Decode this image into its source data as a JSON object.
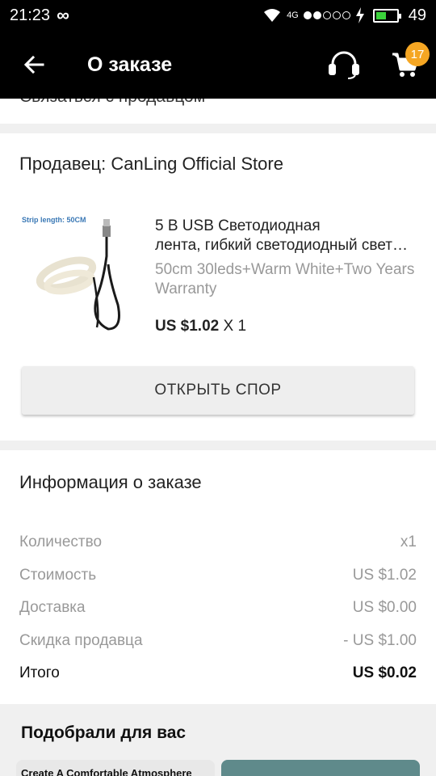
{
  "status_bar": {
    "time": "21:23",
    "network": "4G",
    "battery_level": "49",
    "battery_fill_fraction": 0.49
  },
  "app_bar": {
    "title": "О заказе",
    "cart_badge": "17"
  },
  "contact_seller": {
    "label": "Связаться с продавцом"
  },
  "seller_section": {
    "seller_label": "Продавец: CanLing Official Store",
    "product": {
      "image_caption": "Strip length: 50CM",
      "title_line1": "5 В USB Светодиодная",
      "title_line2": "лента, гибкий светодиодный светильник",
      "variant": "50cm 30leds+Warm White+Two Years Warranty",
      "price": "US $1.02",
      "quantity": "X 1"
    },
    "dispute_button": "ОТКРЫТЬ СПОР"
  },
  "order_info": {
    "title": "Информация о заказе",
    "rows": [
      {
        "label": "Количество",
        "value": "x1"
      },
      {
        "label": "Стоимость",
        "value": "US $1.02"
      },
      {
        "label": "Доставка",
        "value": "US $0.00"
      },
      {
        "label": "Скидка продавца",
        "value": "- US $1.00"
      }
    ],
    "total": {
      "label": "Итого",
      "value": "US $0.02"
    }
  },
  "recommendations": {
    "title": "Подобрали для вас",
    "card1_text": "Create A Comfortable Atmosphere"
  },
  "colors": {
    "bar_bg": "#000000",
    "badge": "#f5a623",
    "battery": "#3bd33b"
  }
}
